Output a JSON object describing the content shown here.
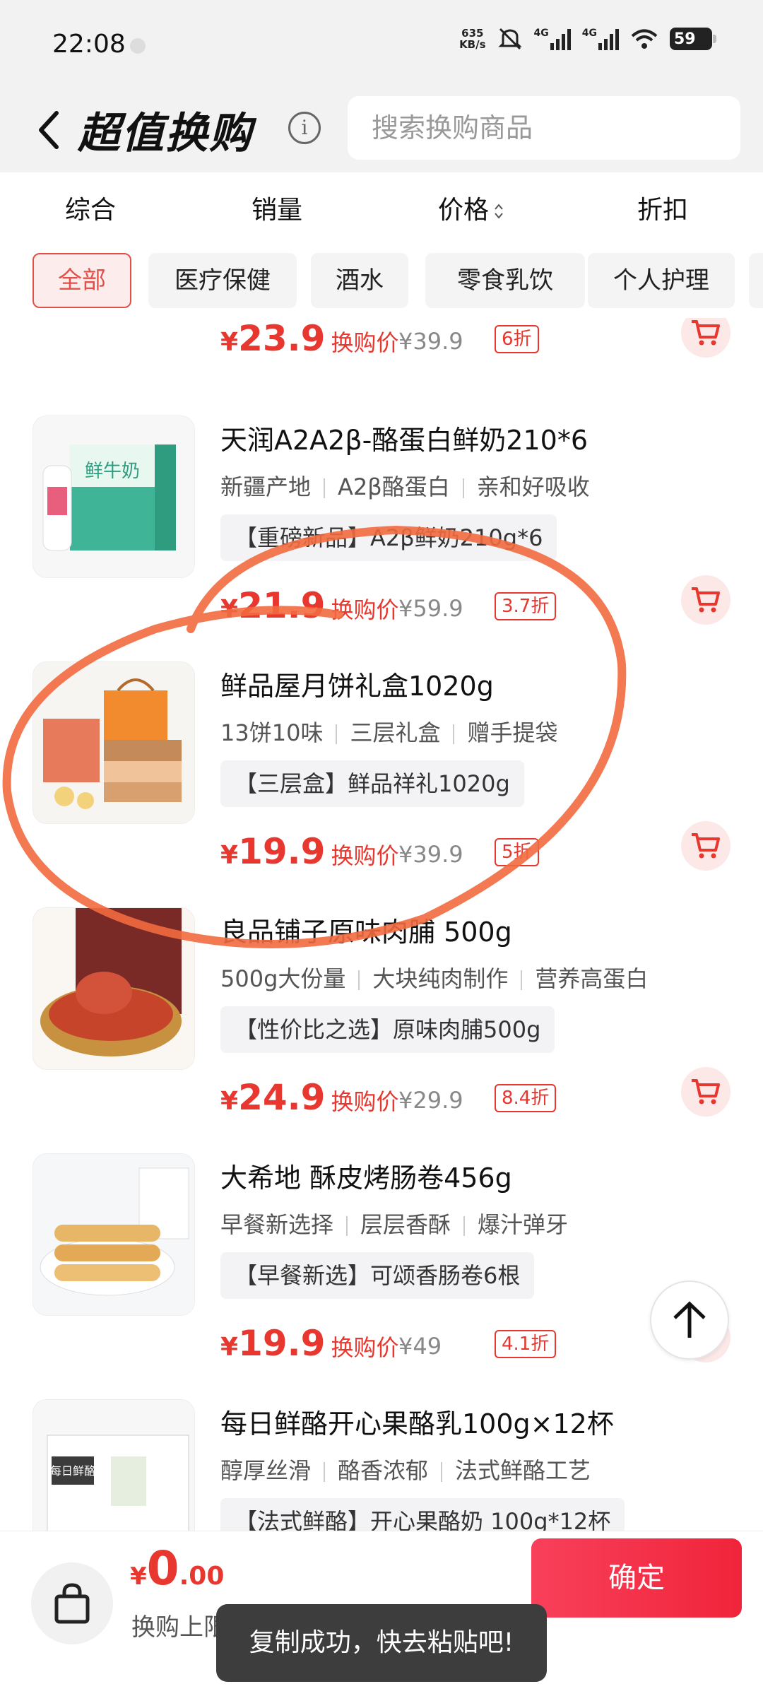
{
  "status_bar": {
    "time": "22:08",
    "net_speed_value": "635",
    "net_speed_unit": "KB/s",
    "signal_1": "4G",
    "signal_2": "4G",
    "battery": "59"
  },
  "header": {
    "title": "超值换购",
    "search_placeholder": "搜索换购商品"
  },
  "sort_tabs": [
    "综合",
    "销量",
    "价格",
    "折扣"
  ],
  "categories": [
    "全部",
    "医疗保健",
    "酒水",
    "零食乳饮",
    "个人护理"
  ],
  "products": [
    {
      "price": "23.9",
      "price_label": "换购价",
      "original": "¥39.9",
      "discount": "6折"
    },
    {
      "name": "天润A2A2β-酪蛋白鲜奶210*6",
      "features": [
        "新疆产地",
        "A2β酪蛋白",
        "亲和好吸收"
      ],
      "promo": "【重磅新品】A2β鲜奶210g*6",
      "price": "21.9",
      "price_label": "换购价",
      "original": "¥59.9",
      "discount": "3.7折",
      "image_text": "鲜牛奶"
    },
    {
      "name": "鲜品屋月饼礼盒1020g",
      "features": [
        "13饼10味",
        "三层礼盒",
        "赠手提袋"
      ],
      "promo": "【三层盒】鲜品祥礼1020g",
      "price": "19.9",
      "price_label": "换购价",
      "original": "¥39.9",
      "discount": "5折"
    },
    {
      "name": "良品铺子原味肉脯 500g",
      "features": [
        "500g大份量",
        "大块纯肉制作",
        "营养高蛋白"
      ],
      "promo": "【性价比之选】原味肉脯500g",
      "price": "24.9",
      "price_label": "换购价",
      "original": "¥29.9",
      "discount": "8.4折"
    },
    {
      "name": "大希地 酥皮烤肠卷456g",
      "features": [
        "早餐新选择",
        "层层香酥",
        "爆汁弹牙"
      ],
      "promo": "【早餐新选】可颂香肠卷6根",
      "price": "19.9",
      "price_label": "换购价",
      "original": "¥49",
      "discount": "4.1折"
    },
    {
      "name": "每日鲜酪开心果酪乳100g×12杯",
      "features": [
        "醇厚丝滑",
        "酪香浓郁",
        "法式鲜酪工艺"
      ],
      "promo": "【法式鲜酪】开心果酪奶 100g*12杯",
      "image_text": "每日鲜酪"
    }
  ],
  "bottom_bar": {
    "currency": "¥",
    "total_int": "0",
    "total_dec": ".00",
    "limit": "换购上限 20 件",
    "confirm": "确定"
  },
  "toast": "复制成功，快去粘贴吧!",
  "colors": {
    "accent": "#e8372e",
    "confirm": "#f0243a",
    "annotation": "#f26a3f"
  }
}
